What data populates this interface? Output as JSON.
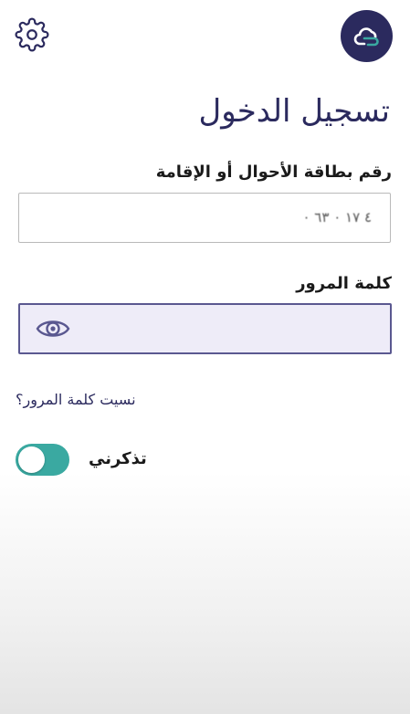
{
  "header": {
    "settings_icon": "gear-icon",
    "logo_icon": "app-logo-icon",
    "brand_color": "#2b2a5e"
  },
  "login": {
    "title": "تسجيل الدخول",
    "id_label": "رقم بطاقة الأحوال أو الإقامة",
    "id_value": "٤ ١٧ ٠ ٦٣ ٠",
    "password_label": "كلمة المرور",
    "password_value": "",
    "show_password_icon": "eye-icon",
    "forgot_password": "نسيت كلمة المرور؟",
    "remember_me_label": "تذكرني",
    "remember_me_on": true,
    "toggle_color": "#3aa9a1",
    "focus_border_color": "#5a5890"
  }
}
